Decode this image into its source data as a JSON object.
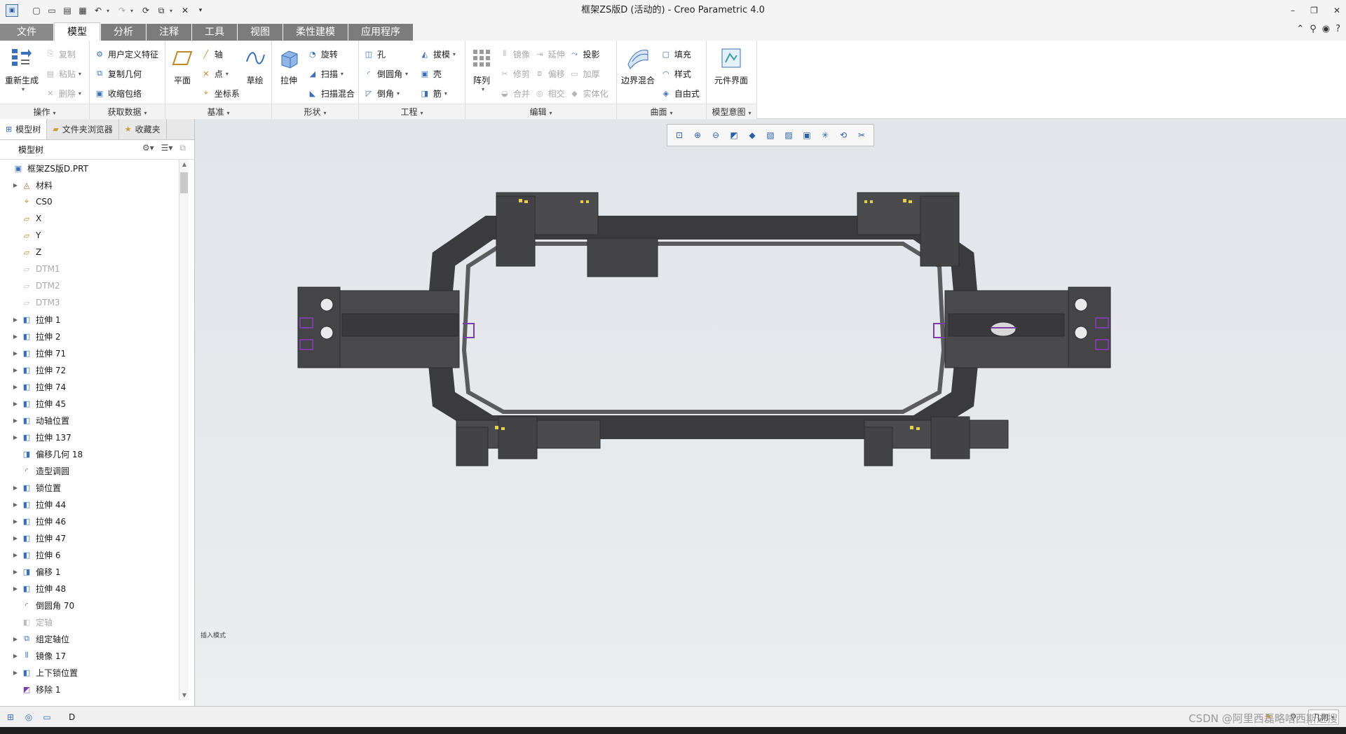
{
  "window": {
    "title": "框架ZS版D (活动的) - Creo Parametric 4.0",
    "controls": [
      "–",
      "❐",
      "✕"
    ]
  },
  "quick_access": [
    "新建",
    "打开",
    "保存",
    "撤销",
    "重做",
    "重新生成",
    "窗口",
    "关闭"
  ],
  "tabs": [
    {
      "label": "文件",
      "active": false
    },
    {
      "label": "模型",
      "active": true
    },
    {
      "label": "分析",
      "active": false
    },
    {
      "label": "注释",
      "active": false
    },
    {
      "label": "工具",
      "active": false
    },
    {
      "label": "视图",
      "active": false
    },
    {
      "label": "柔性建模",
      "active": false
    },
    {
      "label": "应用程序",
      "active": false
    }
  ],
  "ribbon": {
    "operations": {
      "label": "操作",
      "regen": "重新生成",
      "items": [
        {
          "label": "复制",
          "disabled": true
        },
        {
          "label": "粘贴",
          "disabled": true
        },
        {
          "label": "删除",
          "disabled": true
        }
      ]
    },
    "get_data": {
      "label": "获取数据",
      "items": [
        {
          "label": "用户定义特征"
        },
        {
          "label": "复制几何"
        },
        {
          "label": "收缩包络"
        }
      ]
    },
    "datum": {
      "label": "基准",
      "plane": "平面",
      "sketch": "草绘",
      "items": [
        {
          "label": "轴"
        },
        {
          "label": "点"
        },
        {
          "label": "坐标系"
        }
      ]
    },
    "shapes": {
      "label": "形状",
      "extrude": "拉伸",
      "items": [
        {
          "label": "旋转"
        },
        {
          "label": "扫描"
        },
        {
          "label": "扫描混合"
        }
      ]
    },
    "engineering": {
      "label": "工程",
      "col1": [
        {
          "label": "孔"
        },
        {
          "label": "倒圆角"
        },
        {
          "label": "倒角"
        }
      ],
      "col2": [
        {
          "label": "拔模"
        },
        {
          "label": "壳"
        },
        {
          "label": "筋"
        }
      ]
    },
    "editing": {
      "label": "编辑",
      "pattern": "阵列",
      "col1": [
        {
          "label": "镜像",
          "disabled": true
        },
        {
          "label": "修剪",
          "disabled": true
        },
        {
          "label": "合并",
          "disabled": true
        }
      ],
      "col2": [
        {
          "label": "延伸",
          "disabled": true
        },
        {
          "label": "偏移",
          "disabled": true
        },
        {
          "label": "相交",
          "disabled": true
        }
      ],
      "col3": [
        {
          "label": "投影",
          "disabled": false
        },
        {
          "label": "加厚",
          "disabled": true
        },
        {
          "label": "实体化",
          "disabled": true
        }
      ]
    },
    "surfaces": {
      "label": "曲面",
      "boundary": "边界混合",
      "items": [
        {
          "label": "填充"
        },
        {
          "label": "样式"
        },
        {
          "label": "自由式"
        }
      ]
    },
    "model_intent": {
      "label": "模型意图",
      "component": "元件界面"
    }
  },
  "navigator": {
    "tabs": [
      "模型树",
      "文件夹浏览器",
      "收藏夹"
    ],
    "header": "模型树",
    "tree": [
      {
        "label": "框架ZS版D.PRT",
        "icon": "part-icon",
        "expandable": false,
        "root": true,
        "disabled": false
      },
      {
        "label": "材料",
        "icon": "material-icon",
        "expandable": true,
        "disabled": false
      },
      {
        "label": "CS0",
        "icon": "csys-icon",
        "expandable": false,
        "disabled": false
      },
      {
        "label": "X",
        "icon": "plane-icon",
        "expandable": false,
        "disabled": false
      },
      {
        "label": "Y",
        "icon": "plane-icon",
        "expandable": false,
        "disabled": false
      },
      {
        "label": "Z",
        "icon": "plane-icon",
        "expandable": false,
        "disabled": false
      },
      {
        "label": "DTM1",
        "icon": "plane-icon",
        "expandable": false,
        "disabled": true
      },
      {
        "label": "DTM2",
        "icon": "plane-icon",
        "expandable": false,
        "disabled": true
      },
      {
        "label": "DTM3",
        "icon": "plane-icon",
        "expandable": false,
        "disabled": true
      },
      {
        "label": "拉伸 1",
        "icon": "extrude-icon",
        "expandable": true,
        "disabled": false
      },
      {
        "label": "拉伸 2",
        "icon": "extrude-icon",
        "expandable": true,
        "disabled": false
      },
      {
        "label": "拉伸 71",
        "icon": "extrude-icon",
        "expandable": true,
        "disabled": false
      },
      {
        "label": "拉伸 72",
        "icon": "extrude-icon",
        "expandable": true,
        "disabled": false
      },
      {
        "label": "拉伸 74",
        "icon": "extrude-icon",
        "expandable": true,
        "disabled": false
      },
      {
        "label": "拉伸 45",
        "icon": "extrude-icon",
        "expandable": true,
        "disabled": false
      },
      {
        "label": "动轴位置",
        "icon": "extrude-icon",
        "expandable": true,
        "disabled": false
      },
      {
        "label": "拉伸 137",
        "icon": "extrude-icon",
        "expandable": true,
        "disabled": false
      },
      {
        "label": "偏移几何 18",
        "icon": "offset-icon",
        "expandable": false,
        "disabled": false
      },
      {
        "label": "造型调圆",
        "icon": "round-icon",
        "expandable": false,
        "disabled": false
      },
      {
        "label": "锁位置",
        "icon": "extrude-icon",
        "expandable": true,
        "disabled": false
      },
      {
        "label": "拉伸 44",
        "icon": "extrude-icon",
        "expandable": true,
        "disabled": false
      },
      {
        "label": "拉伸 46",
        "icon": "extrude-icon",
        "expandable": true,
        "disabled": false
      },
      {
        "label": "拉伸 47",
        "icon": "extrude-icon",
        "expandable": true,
        "disabled": false
      },
      {
        "label": "拉伸 6",
        "icon": "extrude-icon",
        "expandable": true,
        "disabled": false
      },
      {
        "label": "偏移 1",
        "icon": "offset-icon",
        "expandable": true,
        "disabled": false
      },
      {
        "label": "拉伸 48",
        "icon": "extrude-icon",
        "expandable": true,
        "disabled": false
      },
      {
        "label": "倒圆角 70",
        "icon": "round-icon",
        "expandable": false,
        "disabled": false
      },
      {
        "label": "定轴",
        "icon": "extrude-icon",
        "expandable": false,
        "disabled": true
      },
      {
        "label": "组定轴位",
        "icon": "group-icon",
        "expandable": true,
        "disabled": false
      },
      {
        "label": "镜像 17",
        "icon": "mirror-icon",
        "expandable": true,
        "disabled": false
      },
      {
        "label": "上下锁位置",
        "icon": "extrude-icon",
        "expandable": true,
        "disabled": false
      },
      {
        "label": "移除 1",
        "icon": "remove-icon",
        "expandable": false,
        "disabled": false
      }
    ]
  },
  "viewport": {
    "hint": "插入模式"
  },
  "status": {
    "message": "D",
    "selection_filter": "几何",
    "watermark": "CSDN @阿里西磊略啥西斯进搜"
  }
}
